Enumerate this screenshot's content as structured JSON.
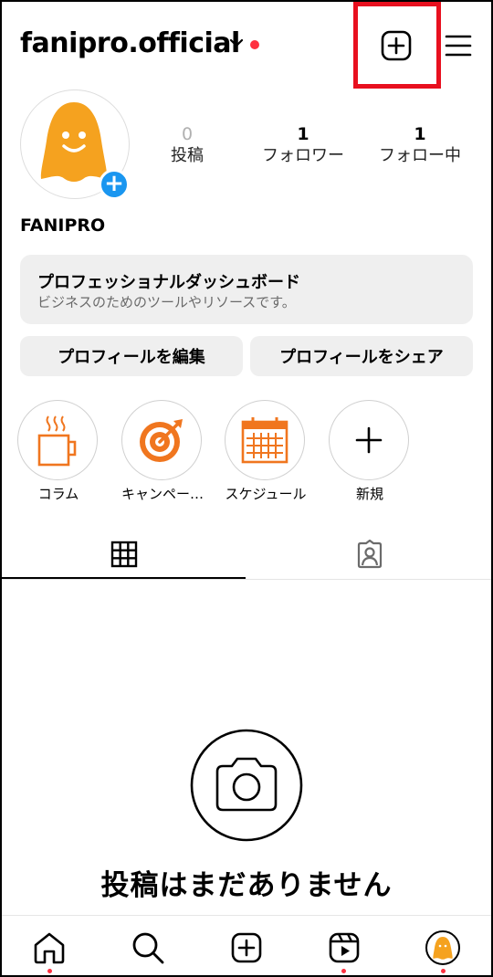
{
  "header": {
    "username": "fanipro.official"
  },
  "profile": {
    "display_name": "FANIPRO",
    "stats": [
      {
        "value": "0",
        "label": "投稿"
      },
      {
        "value": "1",
        "label": "フォロワー"
      },
      {
        "value": "1",
        "label": "フォロー中"
      }
    ]
  },
  "dashboard": {
    "title": "プロフェッショナルダッシュボード",
    "subtitle": "ビジネスのためのツールやリソースです。"
  },
  "buttons": {
    "edit_profile": "プロフィールを編集",
    "share_profile": "プロフィールをシェア"
  },
  "highlights": [
    {
      "label": "コラム",
      "icon": "coffee-cup-icon"
    },
    {
      "label": "キャンペー…",
      "icon": "target-icon"
    },
    {
      "label": "スケジュール",
      "icon": "calendar-icon"
    },
    {
      "label": "新規",
      "icon": "plus-icon"
    }
  ],
  "empty_state": {
    "title": "投稿はまだありません"
  },
  "colors": {
    "accent_orange": "#f0761f",
    "avatar_orange": "#f5a21f",
    "highlight_box": "#e8101f",
    "notification_red": "#ff3040",
    "story_blue": "#1a96f0"
  }
}
